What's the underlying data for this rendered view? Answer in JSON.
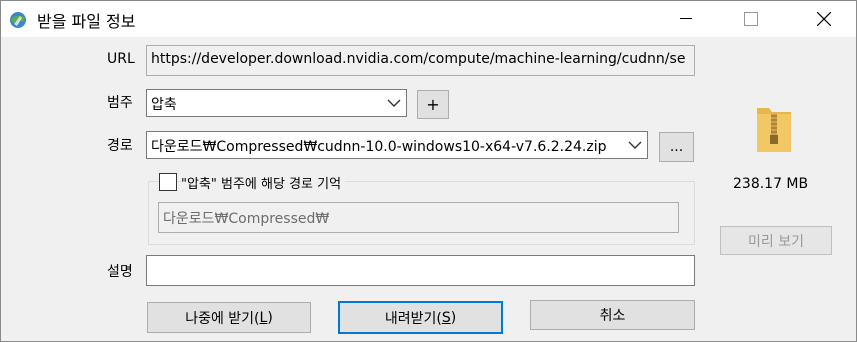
{
  "window": {
    "title": "받을 파일 정보",
    "controls": {
      "minimize": "—",
      "maximize": "□",
      "close": "✕"
    }
  },
  "form": {
    "url_label": "URL",
    "url_value": "https://developer.download.nvidia.com/compute/machine-learning/cudnn/se",
    "category_label": "범주",
    "category_value": "압축",
    "add_category_label": "+",
    "path_label": "경로",
    "path_value": "다운로드₩Compressed₩cudnn-10.0-windows10-x64-v7.6.2.24.zip",
    "browse_label": "...",
    "remember_checkbox_label": "\"압축\" 범주에 해당 경로 기억",
    "remember_checked": false,
    "remembered_path": "다운로드₩Compressed₩",
    "description_label": "설명",
    "description_value": ""
  },
  "file_info": {
    "icon": "zip-folder-icon",
    "size": "238.17  MB",
    "preview_label": "미리 보기"
  },
  "buttons": {
    "later_text": "나중에 받기(",
    "later_key": "L",
    "later_close": ")",
    "download_text": "내려받기(",
    "download_key": "S",
    "download_close": ")",
    "cancel": "취소"
  },
  "colors": {
    "accent": "#0078d7",
    "zip_folder": "#f2c766"
  }
}
